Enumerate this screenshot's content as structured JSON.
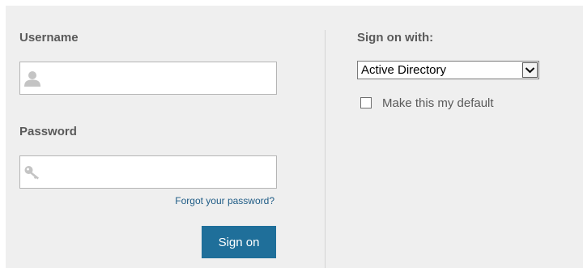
{
  "login": {
    "username_label": "Username",
    "username_value": "",
    "password_label": "Password",
    "password_value": "",
    "forgot_link": "Forgot your password?",
    "signon_button": "Sign on"
  },
  "signon_options": {
    "label": "Sign on with:",
    "selected": "Active Directory",
    "default_checkbox_label": "Make this my default",
    "default_checked": false
  },
  "icons": {
    "username": "user-icon",
    "password": "key-icon",
    "dropdown": "chevron-down-icon"
  },
  "colors": {
    "panel_bg": "#efefef",
    "button_bg": "#1f6f9a",
    "link": "#1f5c86",
    "label_text": "#5a5a5a"
  }
}
